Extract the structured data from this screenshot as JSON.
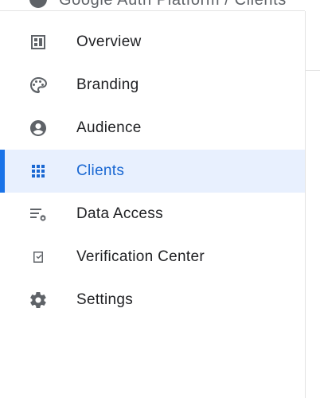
{
  "header": {
    "breadcrumb_text": "Google Auth Platform / Clients"
  },
  "sidebar": {
    "items": [
      {
        "label": "Overview",
        "icon": "dashboard-icon"
      },
      {
        "label": "Branding",
        "icon": "palette-icon"
      },
      {
        "label": "Audience",
        "icon": "account-circle-icon"
      },
      {
        "label": "Clients",
        "icon": "apps-grid-icon",
        "active": true
      },
      {
        "label": "Data Access",
        "icon": "data-settings-icon"
      },
      {
        "label": "Verification Center",
        "icon": "checkbox-icon"
      },
      {
        "label": "Settings",
        "icon": "gear-icon"
      }
    ]
  },
  "colors": {
    "accent": "#1a73e8",
    "active_bg": "#e8f0fe",
    "active_text": "#1967d2",
    "icon": "#5f6368",
    "divider": "#e3e3e3"
  }
}
